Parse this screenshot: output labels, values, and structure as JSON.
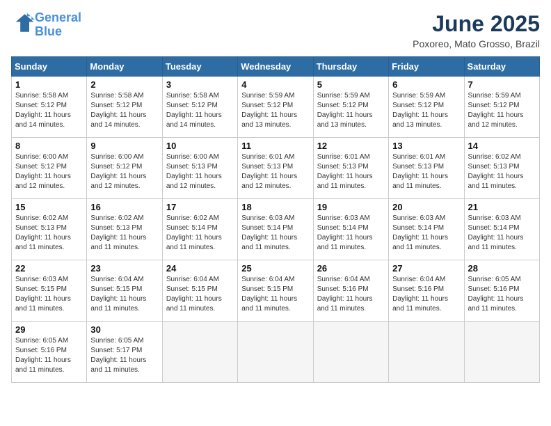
{
  "header": {
    "logo_line1": "General",
    "logo_line2": "Blue",
    "month_year": "June 2025",
    "location": "Poxoreo, Mato Grosso, Brazil"
  },
  "weekdays": [
    "Sunday",
    "Monday",
    "Tuesday",
    "Wednesday",
    "Thursday",
    "Friday",
    "Saturday"
  ],
  "weeks": [
    [
      {
        "day": "1",
        "sunrise": "5:58 AM",
        "sunset": "5:12 PM",
        "daylight": "11 hours and 14 minutes."
      },
      {
        "day": "2",
        "sunrise": "5:58 AM",
        "sunset": "5:12 PM",
        "daylight": "11 hours and 14 minutes."
      },
      {
        "day": "3",
        "sunrise": "5:58 AM",
        "sunset": "5:12 PM",
        "daylight": "11 hours and 14 minutes."
      },
      {
        "day": "4",
        "sunrise": "5:59 AM",
        "sunset": "5:12 PM",
        "daylight": "11 hours and 13 minutes."
      },
      {
        "day": "5",
        "sunrise": "5:59 AM",
        "sunset": "5:12 PM",
        "daylight": "11 hours and 13 minutes."
      },
      {
        "day": "6",
        "sunrise": "5:59 AM",
        "sunset": "5:12 PM",
        "daylight": "11 hours and 13 minutes."
      },
      {
        "day": "7",
        "sunrise": "5:59 AM",
        "sunset": "5:12 PM",
        "daylight": "11 hours and 12 minutes."
      }
    ],
    [
      {
        "day": "8",
        "sunrise": "6:00 AM",
        "sunset": "5:12 PM",
        "daylight": "11 hours and 12 minutes."
      },
      {
        "day": "9",
        "sunrise": "6:00 AM",
        "sunset": "5:12 PM",
        "daylight": "11 hours and 12 minutes."
      },
      {
        "day": "10",
        "sunrise": "6:00 AM",
        "sunset": "5:13 PM",
        "daylight": "11 hours and 12 minutes."
      },
      {
        "day": "11",
        "sunrise": "6:01 AM",
        "sunset": "5:13 PM",
        "daylight": "11 hours and 12 minutes."
      },
      {
        "day": "12",
        "sunrise": "6:01 AM",
        "sunset": "5:13 PM",
        "daylight": "11 hours and 11 minutes."
      },
      {
        "day": "13",
        "sunrise": "6:01 AM",
        "sunset": "5:13 PM",
        "daylight": "11 hours and 11 minutes."
      },
      {
        "day": "14",
        "sunrise": "6:02 AM",
        "sunset": "5:13 PM",
        "daylight": "11 hours and 11 minutes."
      }
    ],
    [
      {
        "day": "15",
        "sunrise": "6:02 AM",
        "sunset": "5:13 PM",
        "daylight": "11 hours and 11 minutes."
      },
      {
        "day": "16",
        "sunrise": "6:02 AM",
        "sunset": "5:13 PM",
        "daylight": "11 hours and 11 minutes."
      },
      {
        "day": "17",
        "sunrise": "6:02 AM",
        "sunset": "5:14 PM",
        "daylight": "11 hours and 11 minutes."
      },
      {
        "day": "18",
        "sunrise": "6:03 AM",
        "sunset": "5:14 PM",
        "daylight": "11 hours and 11 minutes."
      },
      {
        "day": "19",
        "sunrise": "6:03 AM",
        "sunset": "5:14 PM",
        "daylight": "11 hours and 11 minutes."
      },
      {
        "day": "20",
        "sunrise": "6:03 AM",
        "sunset": "5:14 PM",
        "daylight": "11 hours and 11 minutes."
      },
      {
        "day": "21",
        "sunrise": "6:03 AM",
        "sunset": "5:14 PM",
        "daylight": "11 hours and 11 minutes."
      }
    ],
    [
      {
        "day": "22",
        "sunrise": "6:03 AM",
        "sunset": "5:15 PM",
        "daylight": "11 hours and 11 minutes."
      },
      {
        "day": "23",
        "sunrise": "6:04 AM",
        "sunset": "5:15 PM",
        "daylight": "11 hours and 11 minutes."
      },
      {
        "day": "24",
        "sunrise": "6:04 AM",
        "sunset": "5:15 PM",
        "daylight": "11 hours and 11 minutes."
      },
      {
        "day": "25",
        "sunrise": "6:04 AM",
        "sunset": "5:15 PM",
        "daylight": "11 hours and 11 minutes."
      },
      {
        "day": "26",
        "sunrise": "6:04 AM",
        "sunset": "5:16 PM",
        "daylight": "11 hours and 11 minutes."
      },
      {
        "day": "27",
        "sunrise": "6:04 AM",
        "sunset": "5:16 PM",
        "daylight": "11 hours and 11 minutes."
      },
      {
        "day": "28",
        "sunrise": "6:05 AM",
        "sunset": "5:16 PM",
        "daylight": "11 hours and 11 minutes."
      }
    ],
    [
      {
        "day": "29",
        "sunrise": "6:05 AM",
        "sunset": "5:16 PM",
        "daylight": "11 hours and 11 minutes."
      },
      {
        "day": "30",
        "sunrise": "6:05 AM",
        "sunset": "5:17 PM",
        "daylight": "11 hours and 11 minutes."
      },
      null,
      null,
      null,
      null,
      null
    ]
  ]
}
